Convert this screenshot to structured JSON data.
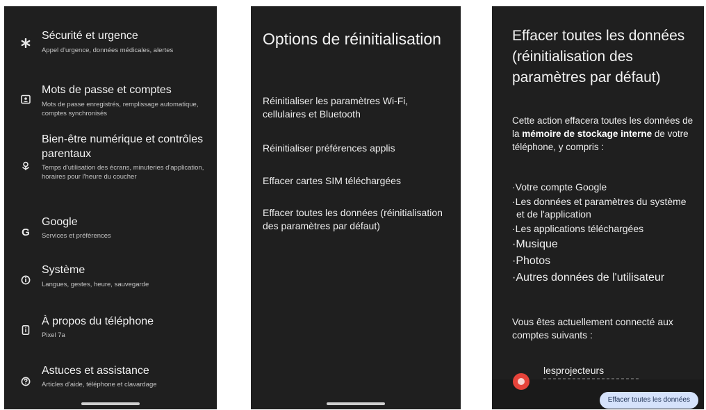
{
  "settings_panel": {
    "items": [
      {
        "title": "Sécurité et urgence",
        "subtitle": "Appel d'urgence, données médicales, alertes",
        "icon": "asterisk-icon"
      },
      {
        "title": "Mots de passe et comptes",
        "subtitle": "Mots de passe enregistrés, remplissage automatique, comptes synchronisés",
        "icon": "account-box-icon"
      },
      {
        "title": "Bien-être numérique et contrôles parentaux",
        "subtitle": "Temps d'utilisation des écrans, minuteries d'application, horaires pour l'heure du coucher",
        "icon": "wellbeing-icon"
      },
      {
        "title": "Google",
        "subtitle": "Services et préférences",
        "icon": "google-icon"
      },
      {
        "title": "Système",
        "subtitle": "Langues, gestes, heure, sauvegarde",
        "icon": "info-circle-icon"
      },
      {
        "title": "À propos du téléphone",
        "subtitle": "Pixel 7a",
        "icon": "phone-info-icon"
      },
      {
        "title": "Astuces et assistance",
        "subtitle": "Articles d'aide, téléphone et clavardage",
        "icon": "help-circle-icon"
      }
    ]
  },
  "reset_panel": {
    "title": "Options de réinitialisation",
    "options": [
      "Réinitialiser les paramètres Wi-Fi, cellulaires et Bluetooth",
      "Réinitialiser préférences applis",
      "Effacer cartes SIM téléchargées",
      "Effacer toutes les données (réinitialisation des paramètres par défaut)"
    ]
  },
  "erase_panel": {
    "title": "Effacer toutes les don­nées (réinitialisation des paramètres par défaut)",
    "desc_before": "Cette action effacera toutes les données de la ",
    "desc_bold": "mémoire de stockage interne",
    "desc_after": " de votre téléphone, y compris :",
    "list": [
      "Votre compte Google",
      "Les données et paramètres du système et de l'application",
      "Les applications téléchargées",
      "Musique",
      "Photos",
      "Autres données de l'utilisateur"
    ],
    "accounts_text": "Vous êtes actuellement connecté aux comptes suivants :",
    "account_name": "lesprojecteurs",
    "button_label": "Effacer toutes les données"
  }
}
